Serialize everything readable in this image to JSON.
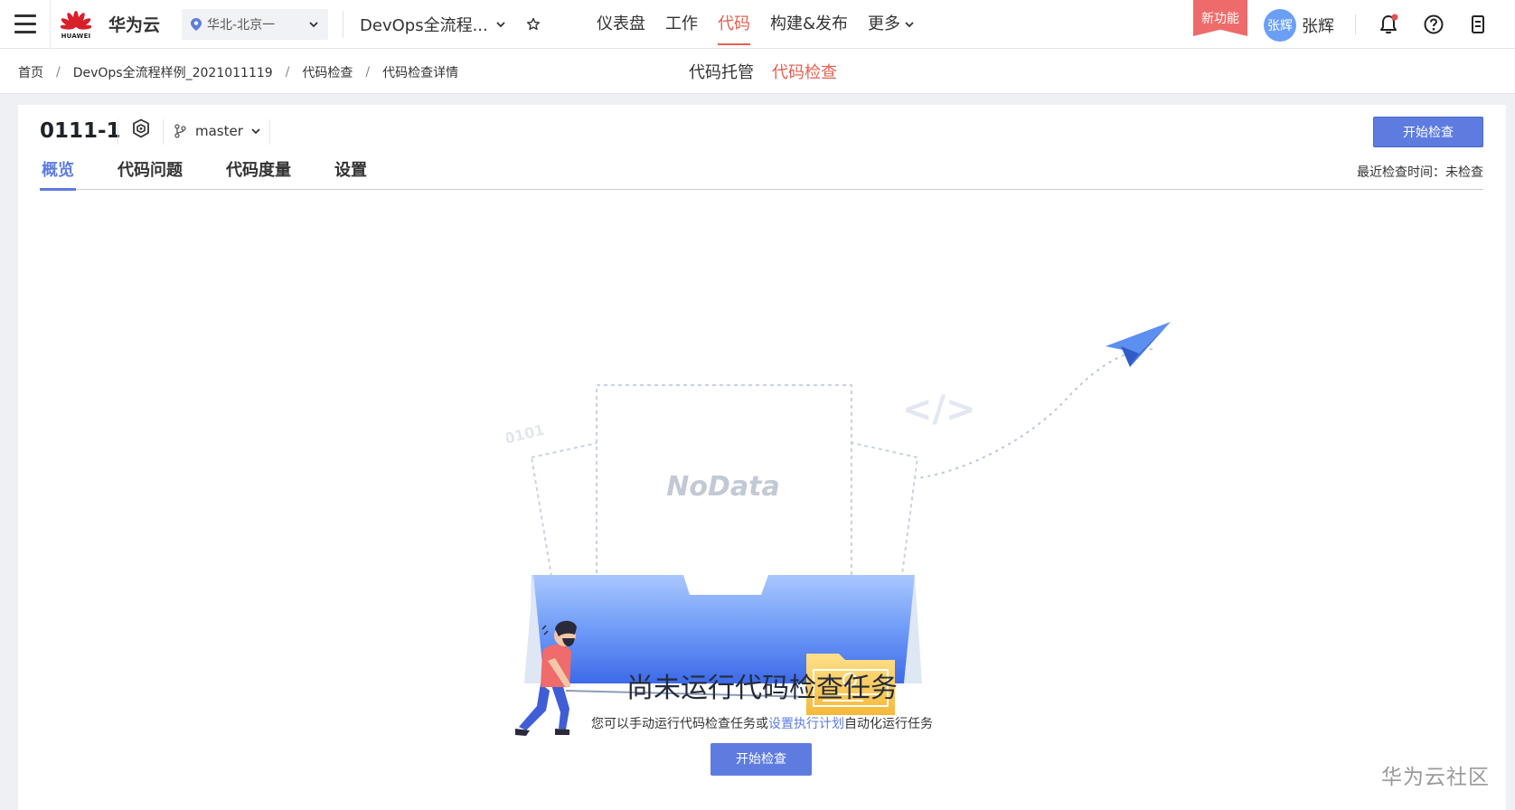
{
  "topbar": {
    "brand_sub": "HUAWEI",
    "brand_name": "华为云",
    "region": "华北-北京一",
    "project": "DevOps全流程...",
    "nav": [
      {
        "label": "仪表盘"
      },
      {
        "label": "工作"
      },
      {
        "label": "代码",
        "active": true
      },
      {
        "label": "构建&发布"
      },
      {
        "label": "更多"
      }
    ],
    "new_feature": "新功能",
    "avatar_text": "张辉",
    "username": "张辉"
  },
  "breadcrumb": [
    "首页",
    "DevOps全流程样例_2021011119",
    "代码检查",
    "代码检查详情"
  ],
  "subtabs": [
    {
      "label": "代码托管"
    },
    {
      "label": "代码检查",
      "active": true
    }
  ],
  "repo": {
    "name": "0111-1",
    "branch": "master"
  },
  "actions": {
    "start_check": "开始检查"
  },
  "tabs": [
    {
      "label": "概览",
      "active": true
    },
    {
      "label": "代码问题"
    },
    {
      "label": "代码度量"
    },
    {
      "label": "设置"
    }
  ],
  "last_check": "最近检查时间：未检查",
  "empty": {
    "illustration_binary": "0101",
    "illustration_nodata": "NoData",
    "title": "尚未运行代码检查任务",
    "desc_prefix": "您可以手动运行代码检查任务或",
    "desc_link": "设置执行计划",
    "desc_suffix": "自动化运行任务"
  },
  "watermark": "华为云社区",
  "colors": {
    "accent": "#5e7ce0",
    "active_nav": "#e5604f",
    "new_feature": "#ef6b6b"
  }
}
